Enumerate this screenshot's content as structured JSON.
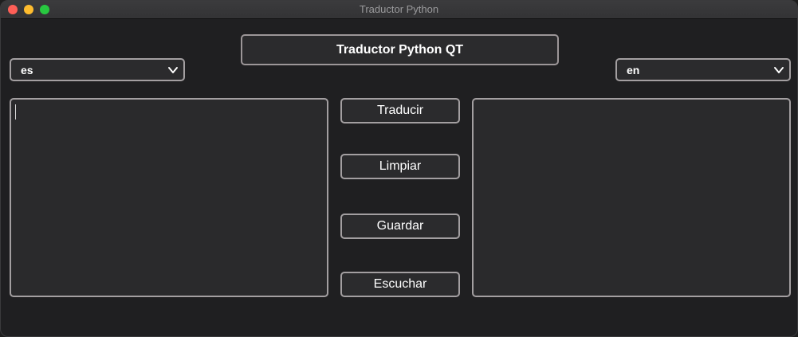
{
  "window": {
    "title": "Traductor Python"
  },
  "header": {
    "title": "Traductor Python QT"
  },
  "source_language": {
    "selected": "es"
  },
  "target_language": {
    "selected": "en"
  },
  "input_text": {
    "value": ""
  },
  "output_text": {
    "value": ""
  },
  "actions": {
    "translate_label": "Traducir",
    "clear_label": "Limpiar",
    "save_label": "Guardar",
    "listen_label": "Escuchar"
  },
  "icons": {
    "close": "close-icon",
    "minimize": "minimize-icon",
    "maximize": "maximize-icon",
    "dropdown": "chevron-down-icon"
  },
  "colors": {
    "background": "#1f1f21",
    "border": "#a39fa1",
    "field": "#2b2b2d",
    "text": "#ffffff"
  }
}
